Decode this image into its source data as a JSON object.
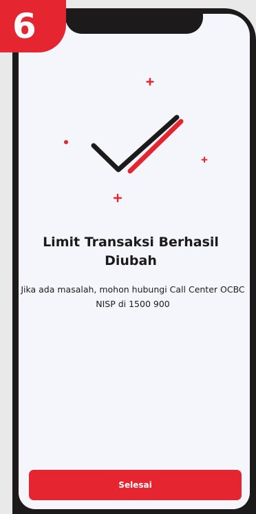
{
  "step": {
    "number": "6"
  },
  "success": {
    "title": "Limit Transaksi Berhasil Diubah",
    "description": "Jika ada masalah, mohon hubungi Call Center OCBC NISP di 1500 900"
  },
  "actions": {
    "done_label": "Selesai"
  },
  "icons": {
    "illustration": "success-checkmark-icon"
  },
  "colors": {
    "accent": "#e5252f",
    "dark": "#1d1a1b",
    "screen": "#f5f6fb"
  }
}
